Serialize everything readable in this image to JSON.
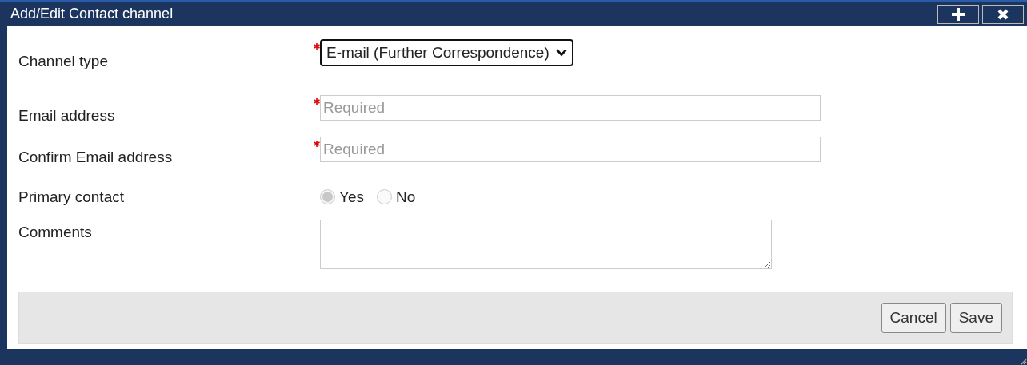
{
  "window": {
    "title": "Add/Edit Contact channel"
  },
  "fields": [
    {
      "kind": "select",
      "label": "Channel type",
      "required": true,
      "value": "E-mail (Further Correspondence)"
    },
    {
      "kind": "text",
      "label": "Email address",
      "required": true,
      "placeholder": "Required"
    },
    {
      "kind": "text",
      "label": "Confirm Email address",
      "required": true,
      "placeholder": "Required"
    },
    {
      "kind": "radio",
      "label": "Primary contact",
      "required": false,
      "disabled": true,
      "options": [
        {
          "label": "Yes",
          "selected": true
        },
        {
          "label": "No",
          "selected": false
        }
      ]
    },
    {
      "kind": "textarea",
      "label": "Comments",
      "required": false
    }
  ],
  "buttons": [
    {
      "label": "Cancel"
    },
    {
      "label": "Save"
    }
  ]
}
